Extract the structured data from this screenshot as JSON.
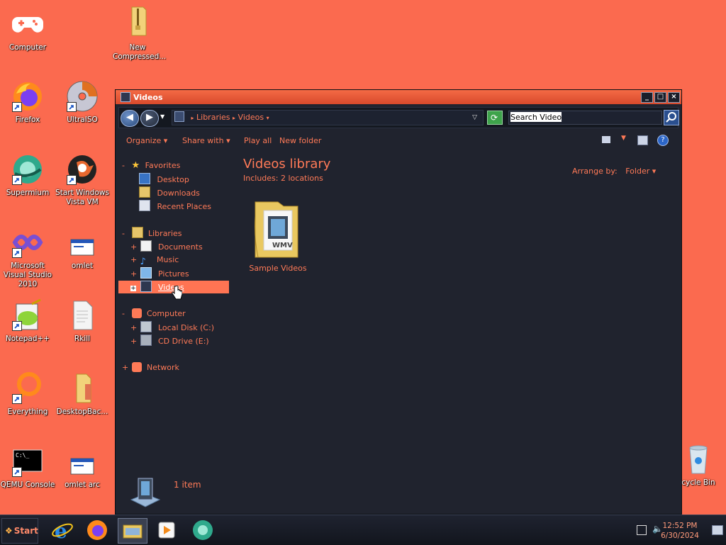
{
  "desktop": {
    "icons": [
      {
        "label": "Computer"
      },
      {
        "label": "New Compressed..."
      },
      {
        "label": "Firefox"
      },
      {
        "label": "UltraISO"
      },
      {
        "label": "Supermium"
      },
      {
        "label": "Start Windows Vista VM"
      },
      {
        "label": "Microsoft Visual Studio 2010"
      },
      {
        "label": "omlet"
      },
      {
        "label": "Notepad++"
      },
      {
        "label": "Rkill"
      },
      {
        "label": "Everything"
      },
      {
        "label": "DesktopBac..."
      },
      {
        "label": "QEMU Console"
      },
      {
        "label": "omlet arc"
      },
      {
        "label": "cycle Bin"
      }
    ]
  },
  "window": {
    "title": "Videos",
    "breadcrumb": [
      "Libraries",
      "Videos"
    ],
    "search_placeholder": "Search Videos",
    "commands": {
      "organize": "Organize",
      "share_with": "Share with",
      "play_all": "Play all",
      "new_folder": "New folder"
    },
    "nav": {
      "favorites": "Favorites",
      "desktop": "Desktop",
      "downloads": "Downloads",
      "recent_places": "Recent Places",
      "libraries": "Libraries",
      "documents": "Documents",
      "music": "Music",
      "pictures": "Pictures",
      "videos": "Videos",
      "computer": "Computer",
      "local_disk": "Local Disk (C:)",
      "cd_drive": "CD Drive (E:)",
      "network": "Network"
    },
    "library_title": "Videos library",
    "includes_label": "Includes:",
    "includes_value": "2 locations",
    "arrange_by_label": "Arrange by:",
    "arrange_by_value": "Folder",
    "items": [
      {
        "label": "Sample Videos"
      }
    ],
    "status": "1 item"
  },
  "taskbar": {
    "start_label": "Start",
    "clock_time": "12:52 PM",
    "clock_date": "6/30/2024"
  }
}
